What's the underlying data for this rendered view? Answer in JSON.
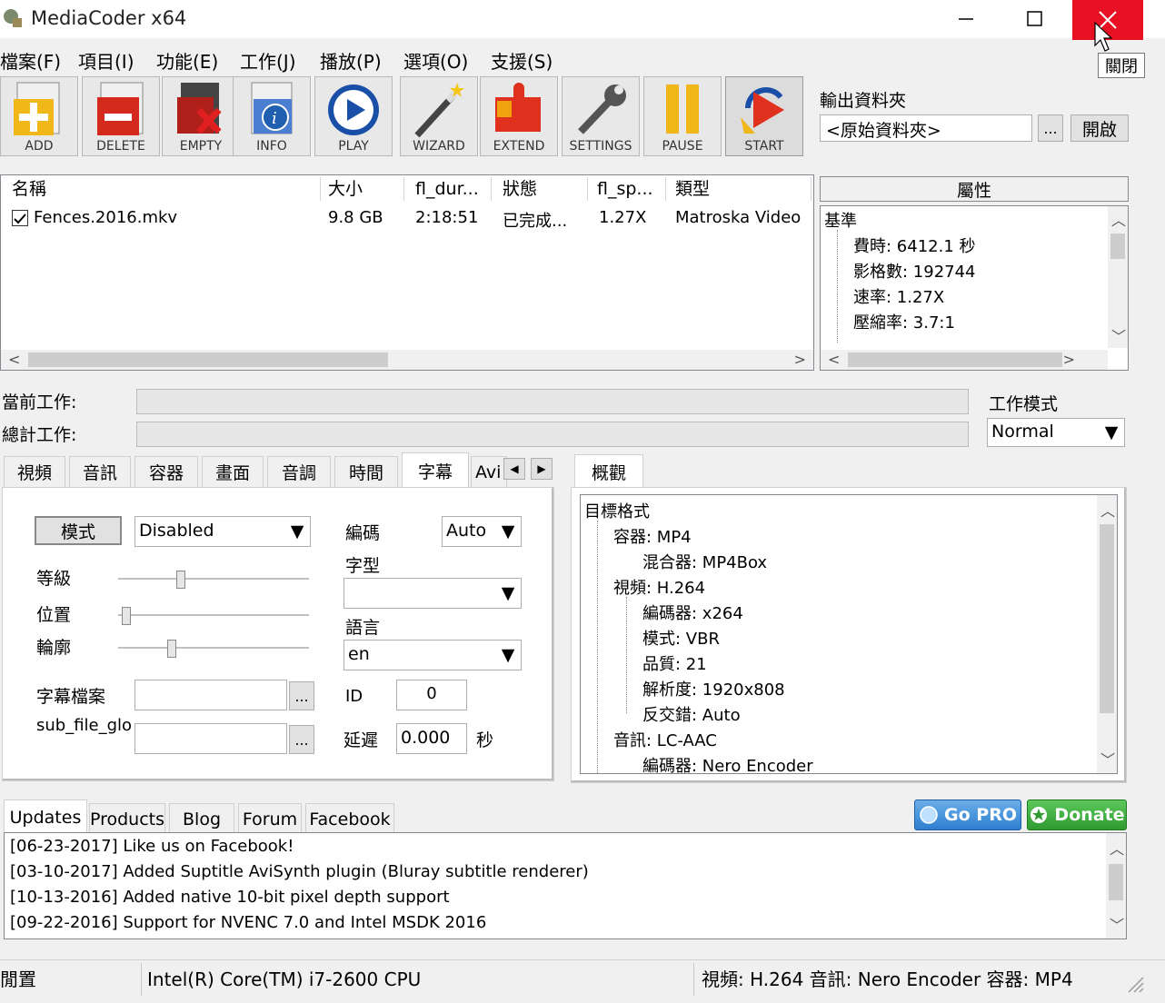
{
  "window": {
    "title": "MediaCoder x64",
    "close_tooltip": "關閉"
  },
  "menu": [
    "檔案(F)",
    "項目(I)",
    "功能(E)",
    "工作(J)",
    "播放(P)",
    "選項(O)",
    "支援(S)"
  ],
  "toolbar": {
    "buttons": [
      "ADD",
      "DELETE",
      "EMPTY",
      "INFO",
      "PLAY",
      "WIZARD",
      "EXTEND",
      "SETTINGS",
      "PAUSE",
      "START"
    ]
  },
  "output": {
    "label": "輸出資料夾",
    "value": "<原始資料夾>",
    "browse": "...",
    "open": "開啟"
  },
  "file_list": {
    "columns": [
      "名稱",
      "大小",
      "fl_dur...",
      "狀態",
      "fl_sp...",
      "類型"
    ],
    "rows": [
      {
        "name": "Fences.2016.mkv",
        "size": "9.8 GB",
        "duration": "2:18:51",
        "status": "已完成...",
        "speed": "1.27X",
        "type": "Matroska Video"
      }
    ]
  },
  "properties": {
    "header": "屬性",
    "root": "基準",
    "items": [
      "費時: 6412.1 秒",
      "影格數: 192744",
      "速率: 1.27X",
      "壓縮率: 3.7:1"
    ]
  },
  "progress": {
    "current_label": "當前工作:",
    "total_label": "總計工作:",
    "mode_label": "工作模式",
    "mode_value": "Normal"
  },
  "tabs": [
    "視頻",
    "音訊",
    "容器",
    "畫面",
    "音調",
    "時間",
    "字幕",
    "Avi"
  ],
  "subtitle": {
    "mode_button": "模式",
    "mode_value": "Disabled",
    "encoding_label": "編碼",
    "encoding_value": "Auto",
    "font_label": "字型",
    "font_value": "",
    "language_label": "語言",
    "language_value": "en",
    "level_label": "等級",
    "position_label": "位置",
    "outline_label": "輪廓",
    "file_label": "字幕檔案",
    "file_value": "",
    "glob_label": "sub_file_glo",
    "glob_value": "",
    "browse": "...",
    "id_label": "ID",
    "id_value": "0",
    "delay_label": "延遲",
    "delay_value": "0.000",
    "delay_unit": "秒",
    "level_fraction": 0.32,
    "position_fraction": 0.02,
    "outline_fraction": 0.27
  },
  "overview": {
    "tab": "概觀",
    "root": "目標格式",
    "items": [
      "容器: MP4",
      "混合器: MP4Box",
      "視頻: H.264",
      "編碼器: x264",
      "模式: VBR",
      "品質: 21",
      "解析度: 1920x808",
      "反交錯: Auto",
      "音訊: LC-AAC",
      "編碼器: Nero Encoder"
    ]
  },
  "news": {
    "tabs": [
      "Updates",
      "Products",
      "Blog",
      "Forum",
      "Facebook"
    ],
    "go_pro": "Go PRO",
    "donate": "Donate",
    "lines": [
      "[06-23-2017] Like us on Facebook!",
      "[03-10-2017] Added Suptitle AviSynth plugin (Bluray subtitle renderer)",
      "[10-13-2016] Added native 10-bit pixel depth support",
      "[09-22-2016] Support for NVENC 7.0 and Intel MSDK 2016"
    ]
  },
  "status_bar": {
    "left": "閒置",
    "cpu": "Intel(R) Core(TM) i7-2600 CPU",
    "summary": "視頻: H.264 音訊: Nero Encoder 容器: MP4"
  }
}
